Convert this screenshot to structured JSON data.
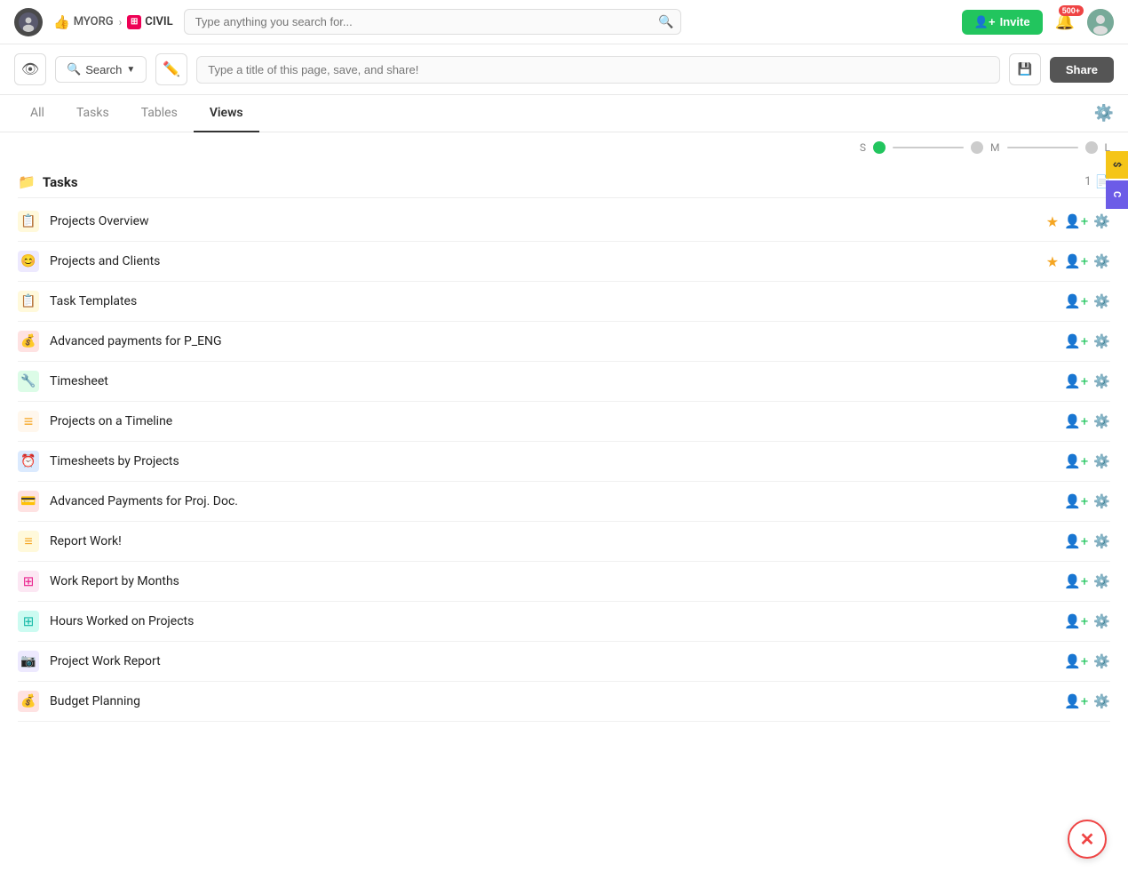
{
  "nav": {
    "org_name": "MYORG",
    "project_name": "CIVIL",
    "search_placeholder": "Type anything you search for...",
    "invite_label": "Invite",
    "notif_count": "500+"
  },
  "toolbar": {
    "search_label": "Search",
    "page_title_placeholder": "Type a title of this page, save, and share!",
    "share_label": "Share"
  },
  "tabs": {
    "items": [
      {
        "id": "all",
        "label": "All"
      },
      {
        "id": "tasks",
        "label": "Tasks"
      },
      {
        "id": "tables",
        "label": "Tables"
      },
      {
        "id": "views",
        "label": "Views"
      }
    ],
    "active": "views"
  },
  "size_selector": {
    "s_label": "S",
    "m_label": "M",
    "l_label": "L"
  },
  "views_group": {
    "title": "Tasks",
    "count": "1"
  },
  "views": [
    {
      "id": 1,
      "name": "Projects Overview",
      "icon": "📋",
      "icon_class": "ic-yellow",
      "starred": true
    },
    {
      "id": 2,
      "name": "Projects and Clients",
      "icon": "😊",
      "icon_class": "ic-purple",
      "starred": true
    },
    {
      "id": 3,
      "name": "Task Templates",
      "icon": "📋",
      "icon_class": "ic-yellow",
      "starred": false
    },
    {
      "id": 4,
      "name": "Advanced payments for P_ENG",
      "icon": "💰",
      "icon_class": "ic-red",
      "starred": false
    },
    {
      "id": 5,
      "name": "Timesheet",
      "icon": "🔧",
      "icon_class": "ic-green",
      "starred": false
    },
    {
      "id": 6,
      "name": "Projects on a Timeline",
      "icon": "☰",
      "icon_class": "ic-orange",
      "starred": false
    },
    {
      "id": 7,
      "name": "Timesheets by Projects",
      "icon": "⏰",
      "icon_class": "ic-blue",
      "starred": false
    },
    {
      "id": 8,
      "name": "Advanced Payments for Proj. Doc.",
      "icon": "💳",
      "icon_class": "ic-red",
      "starred": false
    },
    {
      "id": 9,
      "name": "Report Work!",
      "icon": "≡",
      "icon_class": "ic-yellow",
      "starred": false
    },
    {
      "id": 10,
      "name": "Work Report by Months",
      "icon": "⊞",
      "icon_class": "ic-pink",
      "starred": false
    },
    {
      "id": 11,
      "name": "Hours Worked on Projects",
      "icon": "⊞",
      "icon_class": "ic-teal",
      "starred": false
    },
    {
      "id": 12,
      "name": "Project Work Report",
      "icon": "📷",
      "icon_class": "ic-purple",
      "starred": false
    },
    {
      "id": 13,
      "name": "Budget Planning",
      "icon": "💰",
      "icon_class": "ic-red",
      "starred": false
    }
  ],
  "right_tabs": [
    {
      "id": "yellow-tab",
      "label": "$",
      "color": "yellow"
    },
    {
      "id": "purple-tab",
      "label": "C",
      "color": "purple"
    }
  ]
}
